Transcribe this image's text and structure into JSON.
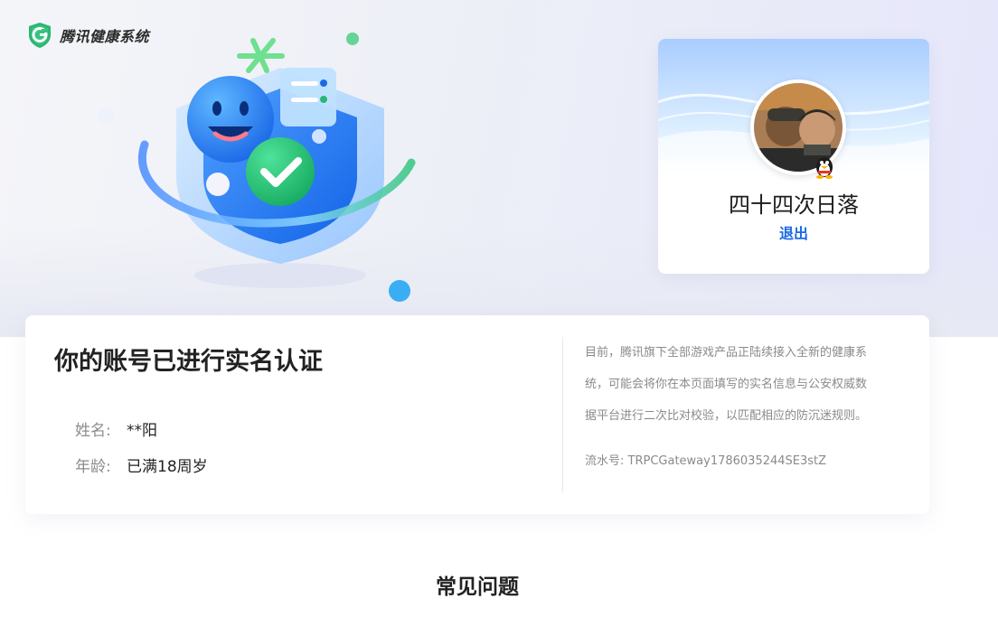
{
  "brand": {
    "logo_icon": "shield-g-icon",
    "name": "腾讯健康系统",
    "accent": "#2bb673"
  },
  "profile": {
    "avatar_icon": "user-avatar",
    "qq_icon": "qq-penguin-icon",
    "name": "四十四次日落",
    "logout_label": "退出",
    "logout_color": "#1a6ae6"
  },
  "verification": {
    "title": "你的账号已进行实名认证",
    "fields": [
      {
        "label": "姓名:",
        "value": "**阳"
      },
      {
        "label": "年龄:",
        "value": "已满18周岁"
      }
    ],
    "notice_lines": [
      "目前，腾讯旗下全部游戏产品正陆续接入全新的健康系",
      "统，可能会将你在本页面填写的实名信息与公安权威数",
      "据平台进行二次比对校验，以匹配相应的防沉迷规则。"
    ],
    "serial_label": "流水号: TRPCGateway1786035244SE3stZ"
  },
  "faq": {
    "title": "常见问题"
  }
}
